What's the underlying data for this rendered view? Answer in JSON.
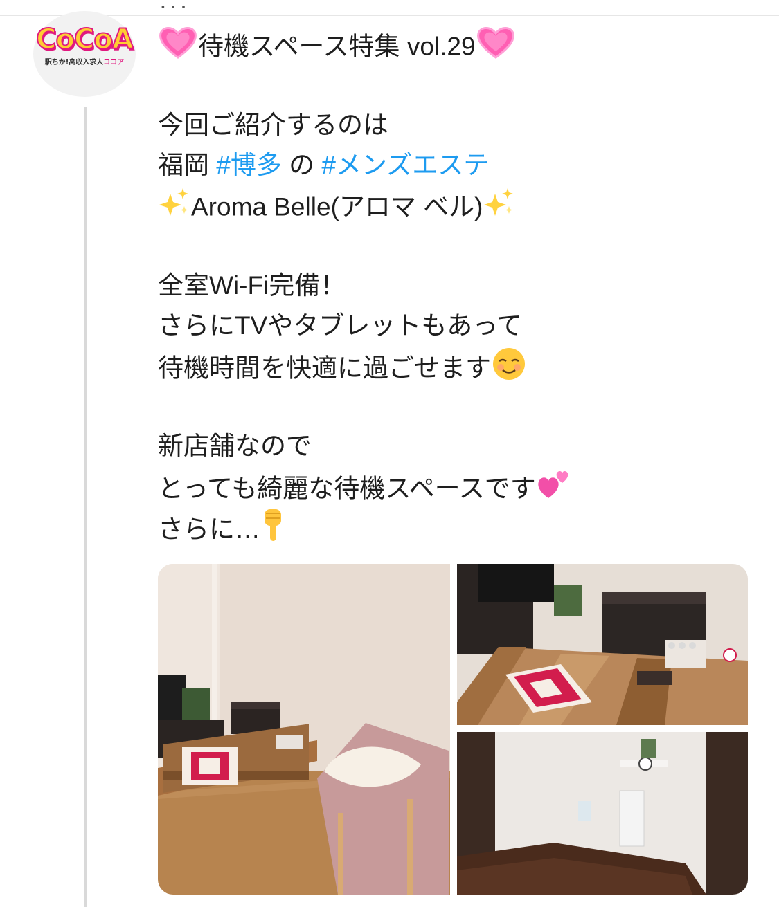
{
  "top_fragment": "...",
  "author": {
    "logo_text": "CoCoA",
    "logo_subtext_dark": "駅ちか!高収入求人",
    "logo_subtext_pink": "ココア"
  },
  "tweet": {
    "title": "待機スペース特集 vol.29",
    "intro": "今回ご紹介するのは",
    "location_prefix": "福岡 ",
    "hashtag_area": "#博多",
    "connector": " の ",
    "hashtag_genre": "#メンズエステ",
    "shop_name": "Aroma Belle(アロマ ベル)",
    "wifi_line": "全室Wi-Fi完備！",
    "tv_line": "さらにTVやタブレットもあって",
    "comfort_line": "待機時間を快適に過ごせます",
    "new_store_line": "新店舗なので",
    "clean_line": "とっても綺麗な待機スペースです",
    "more_line": "さらに…"
  },
  "icons": {
    "title_left": "heart-icon",
    "title_right": "heart-icon",
    "sparkle_left": "sparkles-icon",
    "sparkle_right": "sparkles-icon",
    "smile": "smiling-face-icon",
    "two_hearts": "two-hearts-icon",
    "pointing_down": "pointing-down-icon"
  },
  "colors": {
    "hashtag": "#1d9bf0",
    "text": "#1e1e1e",
    "logo_pink": "#e0187f",
    "logo_yellow": "#ffcc33"
  },
  "media": {
    "photos": [
      {
        "name": "waiting-room-wide-photo"
      },
      {
        "name": "table-closeup-photo"
      },
      {
        "name": "room-corner-photo"
      }
    ]
  }
}
